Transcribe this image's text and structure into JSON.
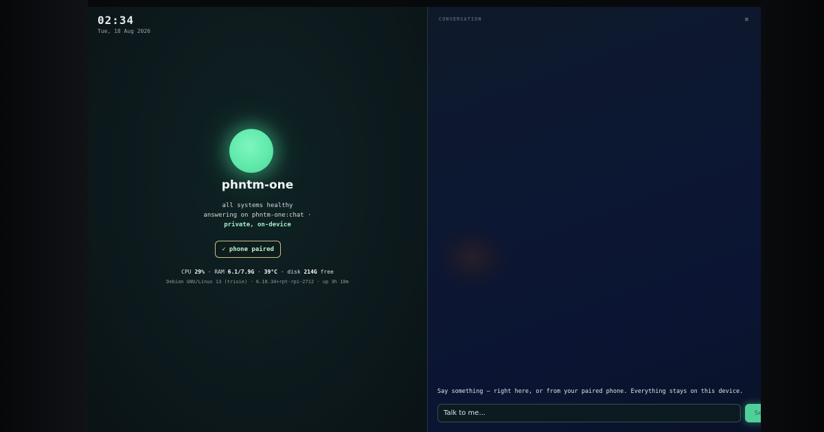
{
  "status_panel": {
    "time": "02:34",
    "date": "Tue, 18 Aug 2026",
    "device_name": "phntm-one",
    "health": "all systems healthy",
    "answering": "answering on phntm-one:chat ·",
    "privacy": "private, on-device",
    "paired_label": "✓ phone paired",
    "stats": {
      "cpu_label": "CPU",
      "cpu_value": "29%",
      "ram_label": "· RAM",
      "ram_value": "6.1/7.9G",
      "temp_value": "39°C",
      "disk_label": "· disk",
      "disk_value": "214G",
      "disk_suffix": "free"
    },
    "system_info": "Debian GNU/Linux 13 (trixie) · 6.18.34+rpt-rpi-2712 · up 3h 10m"
  },
  "conversation": {
    "label": "CONVERSATION",
    "menu_glyph": "≡",
    "hint": "Say something — right here, or from your paired phone. Everything stays on this device.",
    "input_placeholder": "Talk to me...",
    "send_label": "Send"
  },
  "colors": {
    "accent_green": "#5ee8a8",
    "paired_border": "#c9c48a",
    "send_button": "#4fd09a"
  }
}
